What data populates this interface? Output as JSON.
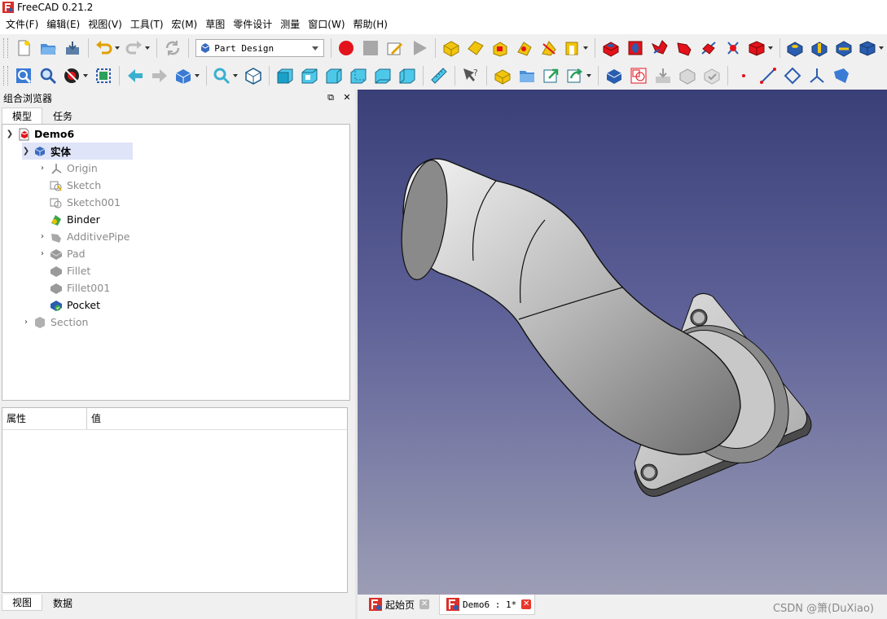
{
  "window": {
    "title": "FreeCAD 0.21.2"
  },
  "menu": [
    "文件(F)",
    "编辑(E)",
    "视图(V)",
    "工具(T)",
    "宏(M)",
    "草图",
    "零件设计",
    "测量",
    "窗口(W)",
    "帮助(H)"
  ],
  "toolbar": {
    "workbench": "Part Design"
  },
  "combo": {
    "title": "组合浏览器",
    "tabs": [
      "模型",
      "任务"
    ],
    "bottom_tabs": [
      "视图",
      "数据"
    ],
    "property_headers": [
      "属性",
      "值"
    ]
  },
  "tree": {
    "document": "Demo6",
    "body": "实体",
    "items": [
      "Origin",
      "Sketch",
      "Sketch001",
      "Binder",
      "AdditivePipe",
      "Pad",
      "Fillet",
      "Fillet001",
      "Pocket"
    ],
    "section": "Section"
  },
  "doc_tabs": [
    "起始页",
    "Demo6 : 1*"
  ],
  "watermark": "CSDN @箫(DuXiao)",
  "colors": {
    "accent_red": "#e8362a",
    "selection": "#e0e4f8",
    "view_top": "#3a3f78",
    "view_bottom": "#9c9db5"
  }
}
